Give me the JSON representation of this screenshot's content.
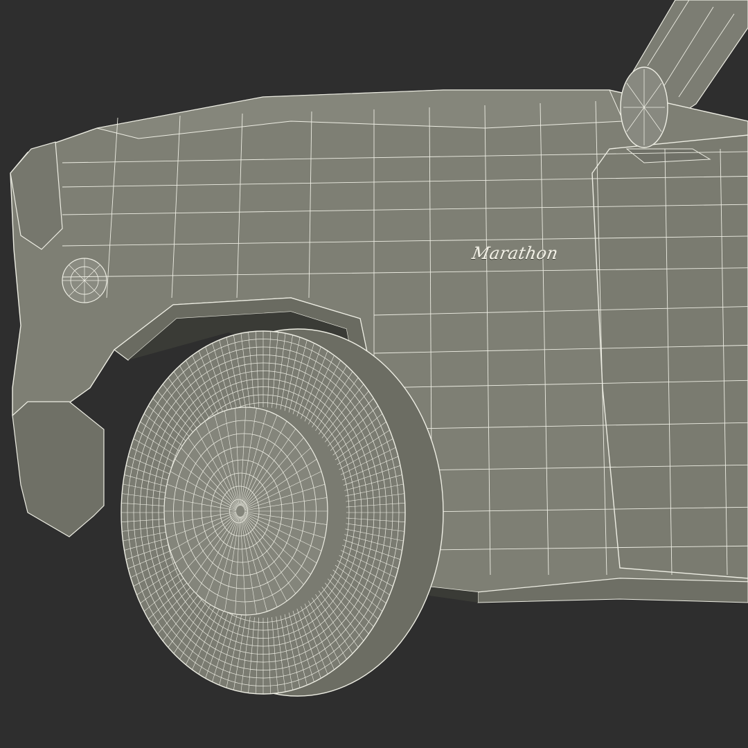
{
  "badge": {
    "text": "Marathon"
  },
  "colors": {
    "background": "#2e2e2e",
    "body": "#7e7f74",
    "body_shade": "#6a6b61",
    "wire": "#eeeee4",
    "tire": "#72736a"
  }
}
